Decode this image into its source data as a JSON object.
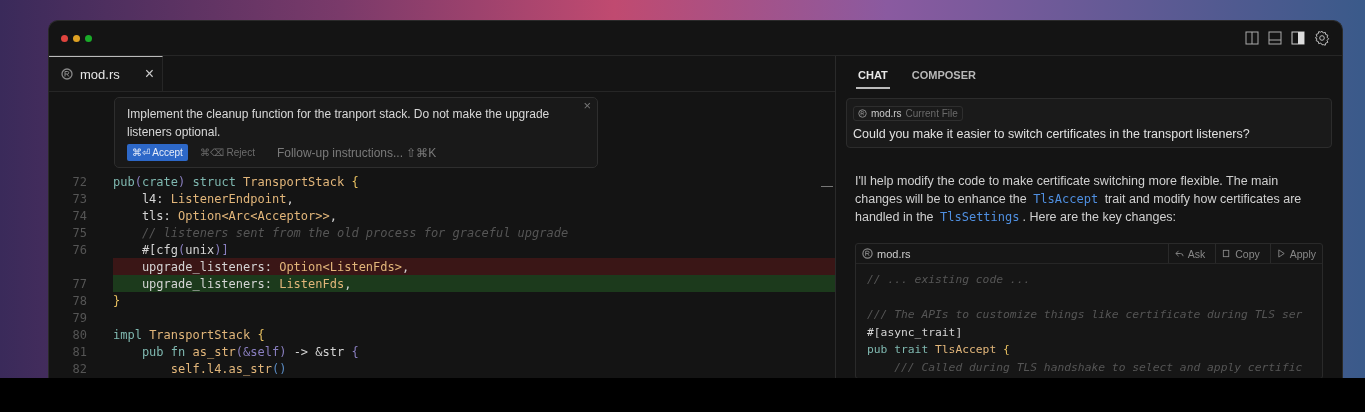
{
  "editor": {
    "tab": {
      "title": "mod.rs",
      "close": "×"
    },
    "inline_prompt": {
      "text": "Implement the cleanup function for the tranport stack. Do not make the upgrade listeners optional.",
      "close": "×",
      "accept": "⌘⏎ Accept",
      "reject": "⌘⌫ Reject",
      "followup_placeholder": "Follow-up instructions... ⇧⌘K"
    },
    "code_lines": [
      {
        "number": "72",
        "kind": "normal",
        "tokens": [
          {
            "text": "pub",
            "kind": "keyword"
          },
          {
            "text": "(",
            "kind": "punct"
          },
          {
            "text": "crate",
            "kind": "keyword"
          },
          {
            "text": ")",
            "kind": "punct"
          },
          {
            "text": " struct ",
            "kind": "keyword"
          },
          {
            "text": "TransportStack",
            "kind": "type"
          },
          {
            "text": " {",
            "kind": "brace"
          }
        ]
      },
      {
        "number": "73",
        "kind": "normal",
        "tokens": [
          {
            "text": "    l4: ",
            "kind": "plain"
          },
          {
            "text": "ListenerEndpoint",
            "kind": "type"
          },
          {
            "text": ",",
            "kind": "plain"
          }
        ]
      },
      {
        "number": "74",
        "kind": "normal",
        "tokens": [
          {
            "text": "    tls: ",
            "kind": "plain"
          },
          {
            "text": "Option<Arc<Acceptor>>",
            "kind": "type"
          },
          {
            "text": ",",
            "kind": "plain"
          }
        ]
      },
      {
        "number": "75",
        "kind": "normal",
        "tokens": [
          {
            "text": "    // listeners sent from the old process for graceful upgrade",
            "kind": "comment"
          }
        ]
      },
      {
        "number": "76",
        "kind": "normal",
        "tokens": [
          {
            "text": "    #[cfg",
            "kind": "plain"
          },
          {
            "text": "(",
            "kind": "punct"
          },
          {
            "text": "unix",
            "kind": "plain"
          },
          {
            "text": ")]",
            "kind": "punct"
          }
        ]
      },
      {
        "kind": "removed",
        "tokens": [
          {
            "text": "    upgrade_listeners: ",
            "kind": "plain"
          },
          {
            "text": "Option<ListenFds>",
            "kind": "type"
          },
          {
            "text": ",",
            "kind": "plain"
          }
        ]
      },
      {
        "number": "77",
        "kind": "added",
        "tokens": [
          {
            "text": "    upgrade_listeners: ",
            "kind": "plain"
          },
          {
            "text": "ListenFds",
            "kind": "type"
          },
          {
            "text": ",",
            "kind": "plain"
          }
        ]
      },
      {
        "number": "78",
        "kind": "normal",
        "tokens": [
          {
            "text": "}",
            "kind": "brace"
          }
        ]
      },
      {
        "number": "79",
        "kind": "normal"
      },
      {
        "number": "80",
        "kind": "normal",
        "tokens": [
          {
            "text": "impl ",
            "kind": "keyword"
          },
          {
            "text": "TransportStack",
            "kind": "type"
          },
          {
            "text": " {",
            "kind": "brace"
          }
        ]
      },
      {
        "number": "81",
        "kind": "normal",
        "tokens": [
          {
            "text": "    pub fn ",
            "kind": "keyword"
          },
          {
            "text": "as_str",
            "kind": "type"
          },
          {
            "text": "(&self)",
            "kind": "punct"
          },
          {
            "text": " -> &str ",
            "kind": "plain"
          },
          {
            "text": "{",
            "kind": "punct"
          }
        ]
      },
      {
        "number": "82",
        "kind": "normal",
        "tokens": [
          {
            "text": "        self.l4.as_str",
            "kind": "type"
          },
          {
            "text": "()",
            "kind": "call"
          }
        ]
      }
    ]
  },
  "chat": {
    "tabs": [
      {
        "label": "CHAT",
        "selected": true
      },
      {
        "label": "COMPOSER",
        "selected": false
      }
    ],
    "user_message": {
      "file_chip": "mod.rs",
      "chip_hint": "Current File",
      "text": "Could you make it easier to switch certificates in the transport listeners?"
    },
    "response": {
      "parts": [
        {
          "text": "I'll help modify the code to make certificate switching more flexible. The main changes will be to enhance the ",
          "kind": "text"
        },
        {
          "text": "TlsAccept",
          "kind": "code"
        },
        {
          "text": " trait and modify how certificates are handled in the ",
          "kind": "text"
        },
        {
          "text": "TlsSettings",
          "kind": "code"
        },
        {
          "text": ". Here are the key changes:",
          "kind": "text"
        }
      ]
    },
    "code_block": {
      "file": "mod.rs",
      "actions": [
        {
          "label": "Ask",
          "kind": "ask"
        },
        {
          "label": "Copy",
          "kind": "copy"
        },
        {
          "label": "Apply",
          "kind": "apply"
        }
      ],
      "lines": [
        {
          "kind": "code",
          "tokens": [
            {
              "text": "// ... existing code ...",
              "kind": "comment"
            }
          ]
        },
        {
          "kind": "blank"
        },
        {
          "kind": "code",
          "tokens": [
            {
              "text": "/// The APIs to customize things like certificate during TLS ser",
              "kind": "comment"
            }
          ]
        },
        {
          "kind": "code",
          "tokens": [
            {
              "text": "#[async_trait]",
              "kind": "plain"
            }
          ]
        },
        {
          "kind": "code",
          "tokens": [
            {
              "text": "pub trait ",
              "kind": "keyword"
            },
            {
              "text": "TlsAccept",
              "kind": "type"
            },
            {
              "text": " {",
              "kind": "brace"
            }
          ]
        },
        {
          "kind": "code",
          "tokens": [
            {
              "text": "    /// Called during TLS handshake to select and apply certific",
              "kind": "comment"
            }
          ]
        }
      ]
    }
  }
}
